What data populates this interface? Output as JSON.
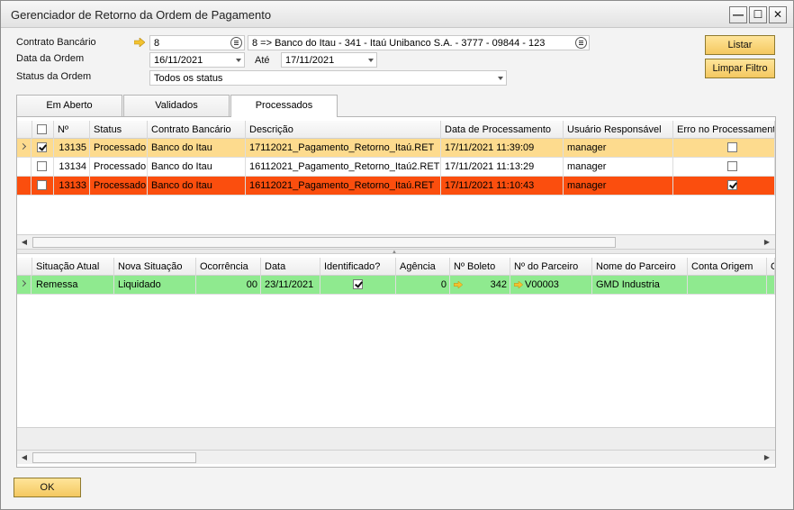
{
  "window": {
    "title": "Gerenciador de Retorno da Ordem de Pagamento",
    "min_label": "—",
    "max_label": "☐",
    "close_label": "✕"
  },
  "filters": {
    "contrato_label": "Contrato Bancário",
    "contrato_value": "8",
    "contrato_desc": "8 => Banco do Itau - 341 - Itaú Unibanco  S.A. - 3777 - 09844 - 123",
    "data_ordem_label": "Data da Ordem",
    "data_de": "16/11/2021",
    "ate_label": "Até",
    "data_ate": "17/11/2021",
    "status_label": "Status da Ordem",
    "status_value": "Todos os status"
  },
  "buttons": {
    "listar": "Listar",
    "limpar": "Limpar Filtro",
    "ok": "OK"
  },
  "tabs": [
    {
      "label": "Em Aberto"
    },
    {
      "label": "Validados"
    },
    {
      "label": "Processados"
    }
  ],
  "top_grid": {
    "headers": [
      "Nº",
      "Status",
      "Contrato Bancário",
      "Descrição",
      "Data de Processamento",
      "Usuário Responsável",
      "Erro no Processamento"
    ],
    "rows": [
      {
        "num": "13135",
        "status": "Processado",
        "contrato": "Banco do Itau",
        "desc": "17112021_Pagamento_Retorno_Itaú.RET",
        "data": "17/11/2021 11:39:09",
        "usuario": "manager",
        "checked": true,
        "erro": false
      },
      {
        "num": "13134",
        "status": "Processado",
        "contrato": "Banco do Itau",
        "desc": "16112021_Pagamento_Retorno_Itaú2.RET",
        "data": "17/11/2021 11:13:29",
        "usuario": "manager",
        "checked": false,
        "erro": false
      },
      {
        "num": "13133",
        "status": "Processado",
        "contrato": "Banco do Itau",
        "desc": "16112021_Pagamento_Retorno_Itaú.RET",
        "data": "17/11/2021 11:10:43",
        "usuario": "manager",
        "checked": false,
        "erro": true
      }
    ],
    "row_colors": [
      "#fddb8e",
      "#ffffff",
      "#fb4e0e"
    ]
  },
  "bottom_grid": {
    "headers": [
      "Situação Atual",
      "Nova Situação",
      "Ocorrência",
      "Data",
      "Identificado?",
      "Agência",
      "Nº Boleto",
      "Nº do Parceiro",
      "Nome do Parceiro",
      "Conta Origem",
      "C"
    ],
    "rows": [
      {
        "atual": "Remessa",
        "nova": "Liquidado",
        "ocorrencia": "00",
        "data": "23/11/2021",
        "identificado": true,
        "agencia": "0",
        "boleto": "342",
        "parceiro": "V00003",
        "nome": "GMD Industria",
        "conta": ""
      }
    ],
    "row_color": "#8fea8f"
  },
  "colors": {
    "accent_button": "#f4c860",
    "link_arrow": "#f2c230"
  },
  "icons": [
    "link-arrow-icon",
    "list-icon",
    "chevron-down-icon",
    "row-indicator-icon",
    "minimize-icon",
    "maximize-icon",
    "close-icon"
  ]
}
